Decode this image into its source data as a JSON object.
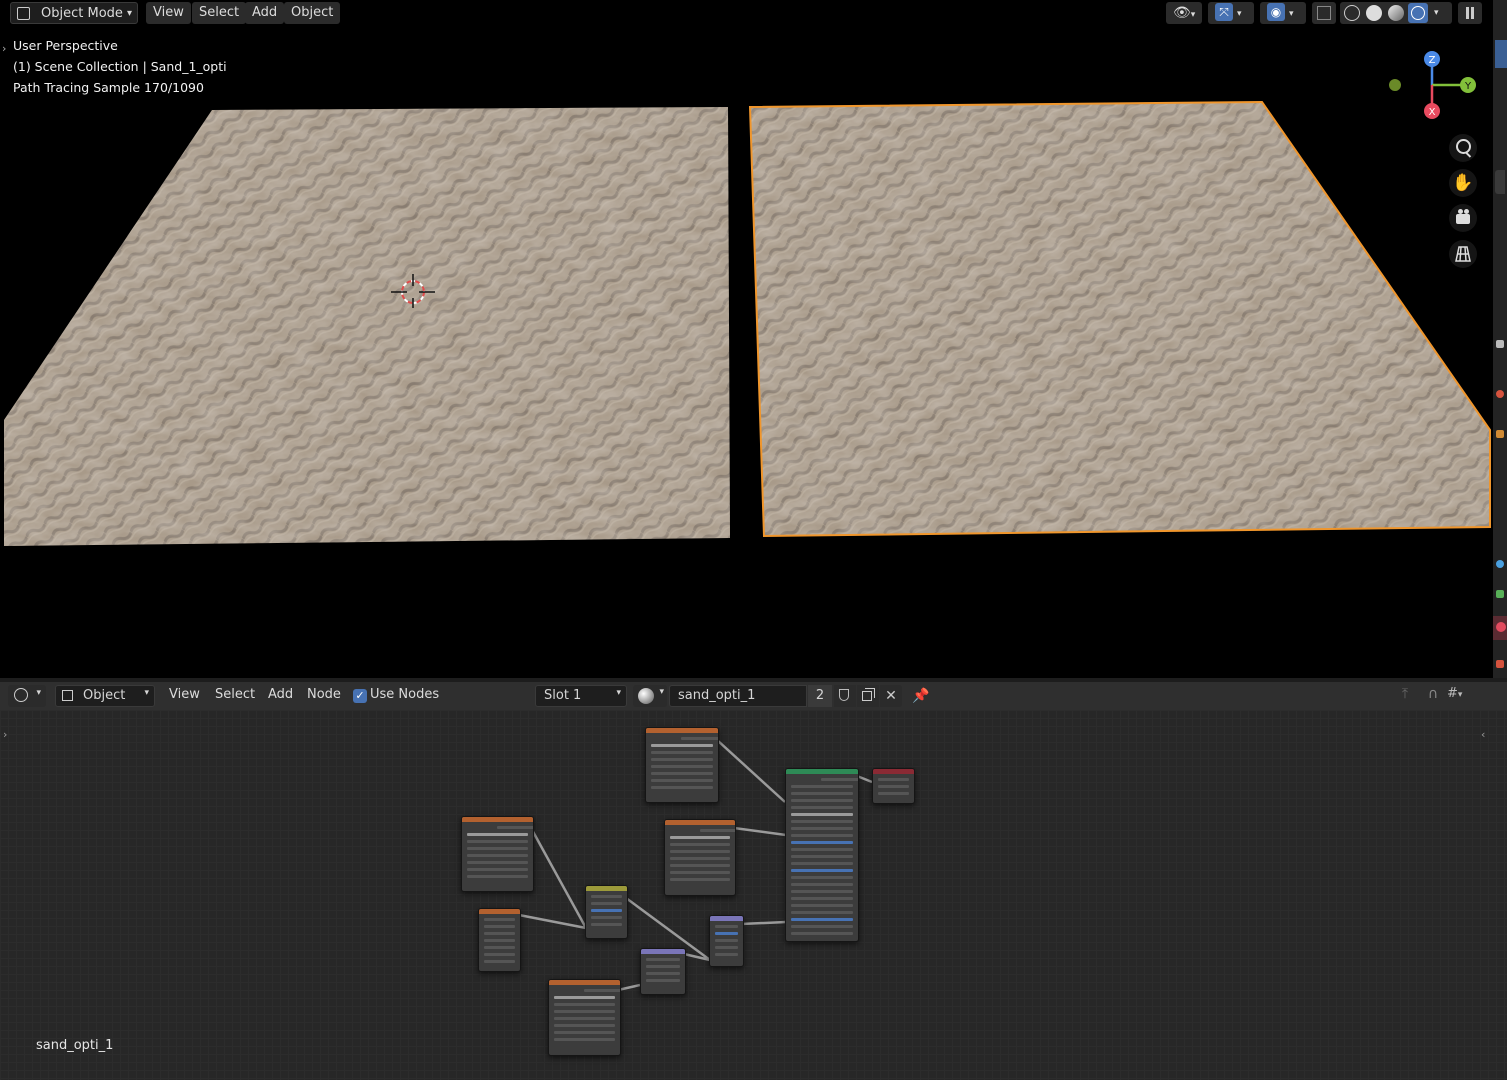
{
  "viewport_header": {
    "mode_label": "Object Mode",
    "menus": [
      "View",
      "Select",
      "Add",
      "Object"
    ]
  },
  "viewport_overlay": {
    "perspective": "User Perspective",
    "collection": "(1) Scene Collection | Sand_1_opti",
    "render_status": "Path Tracing Sample 170/1090"
  },
  "gizmo": {
    "z": "Z",
    "y": "Y",
    "x": "X"
  },
  "node_header": {
    "object_label": "Object",
    "menus": [
      "View",
      "Select",
      "Add",
      "Node"
    ],
    "use_nodes_label": "Use Nodes",
    "use_nodes_checked": true,
    "slot_label": "Slot 1",
    "material_name": "sand_opti_1",
    "user_count": "2"
  },
  "node_editor": {
    "material_caption": "sand_opti_1"
  },
  "colors": {
    "selection_outline": "#f0962c",
    "sand": "#9e9080",
    "accent_blue": "#4772b3",
    "image_node_header": "#b3612f",
    "shader_node_header": "#2e8a56",
    "output_node_header": "#8a2a34",
    "converter_node_header": "#7a75b8",
    "mix_node_header": "#9c9a3a"
  },
  "icons": [
    "editor-type-icon",
    "visibility-icon",
    "gizmo-icon",
    "overlay-icon",
    "xray-icon",
    "shading-wire-icon",
    "shading-solid-icon",
    "shading-material-icon",
    "shading-rendered-icon",
    "zoom-icon",
    "hand-pan-icon",
    "camera-icon",
    "grid-ortho-icon",
    "material-sphere-icon",
    "pin-icon",
    "shield-icon",
    "duplicate-icon",
    "close-icon"
  ]
}
